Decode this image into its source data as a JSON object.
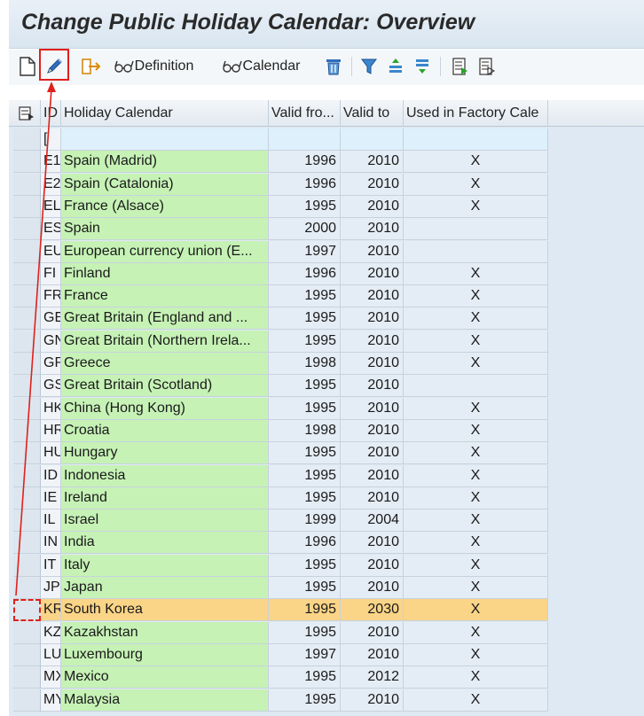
{
  "title": "Change Public Holiday Calendar: Overview",
  "toolbar": {
    "new_icon": "new-document-icon",
    "edit_icon": "pencil-icon",
    "definition_label": "Definition",
    "calendar_label": "Calendar"
  },
  "grid": {
    "columns": {
      "sel": "",
      "id": "ID",
      "name": "Holiday Calendar",
      "valid_from": "Valid fro...",
      "valid_to": "Valid to",
      "used": "Used in Factory Cale"
    },
    "rows": [
      {
        "id": "[",
        "name": "",
        "from": "",
        "to": "",
        "used": ""
      },
      {
        "id": "E1",
        "name": "Spain (Madrid)",
        "from": "1996",
        "to": "2010",
        "used": "X"
      },
      {
        "id": "E2",
        "name": "Spain (Catalonia)",
        "from": "1996",
        "to": "2010",
        "used": "X"
      },
      {
        "id": "EL",
        "name": "France (Alsace)",
        "from": "1995",
        "to": "2010",
        "used": "X"
      },
      {
        "id": "ES",
        "name": "Spain",
        "from": "2000",
        "to": "2010",
        "used": ""
      },
      {
        "id": "EU",
        "name": "European currency union (E...",
        "from": "1997",
        "to": "2010",
        "used": ""
      },
      {
        "id": "FI",
        "name": "Finland",
        "from": "1996",
        "to": "2010",
        "used": "X"
      },
      {
        "id": "FR",
        "name": "France",
        "from": "1995",
        "to": "2010",
        "used": "X"
      },
      {
        "id": "GE",
        "name": "Great Britain (England and ...",
        "from": "1995",
        "to": "2010",
        "used": "X"
      },
      {
        "id": "GN",
        "name": "Great Britain (Northern Irela...",
        "from": "1995",
        "to": "2010",
        "used": "X"
      },
      {
        "id": "GR",
        "name": "Greece",
        "from": "1998",
        "to": "2010",
        "used": "X"
      },
      {
        "id": "GS",
        "name": "Great Britain (Scotland)",
        "from": "1995",
        "to": "2010",
        "used": ""
      },
      {
        "id": "HK",
        "name": "China (Hong Kong)",
        "from": "1995",
        "to": "2010",
        "used": "X"
      },
      {
        "id": "HR",
        "name": "Croatia",
        "from": "1998",
        "to": "2010",
        "used": "X"
      },
      {
        "id": "HU",
        "name": "Hungary",
        "from": "1995",
        "to": "2010",
        "used": "X"
      },
      {
        "id": "ID",
        "name": "Indonesia",
        "from": "1995",
        "to": "2010",
        "used": "X"
      },
      {
        "id": "IE",
        "name": "Ireland",
        "from": "1995",
        "to": "2010",
        "used": "X"
      },
      {
        "id": "IL",
        "name": "Israel",
        "from": "1999",
        "to": "2004",
        "used": "X"
      },
      {
        "id": "IN",
        "name": "India",
        "from": "1996",
        "to": "2010",
        "used": "X"
      },
      {
        "id": "IT",
        "name": "Italy",
        "from": "1995",
        "to": "2010",
        "used": "X"
      },
      {
        "id": "JP",
        "name": "Japan",
        "from": "1995",
        "to": "2010",
        "used": "X"
      },
      {
        "id": "KR",
        "name": "South Korea",
        "from": "1995",
        "to": "2030",
        "used": "X",
        "selected": true
      },
      {
        "id": "KZ",
        "name": "Kazakhstan",
        "from": "1995",
        "to": "2010",
        "used": "X"
      },
      {
        "id": "LU",
        "name": "Luxembourg",
        "from": "1997",
        "to": "2010",
        "used": "X"
      },
      {
        "id": "MX",
        "name": "Mexico",
        "from": "1995",
        "to": "2012",
        "used": "X"
      },
      {
        "id": "MY",
        "name": "Malaysia",
        "from": "1995",
        "to": "2010",
        "used": "X"
      }
    ]
  },
  "colors": {
    "accent_red": "#e0201c",
    "selected_row": "#fad487",
    "name_column": "#c6f2b6"
  }
}
